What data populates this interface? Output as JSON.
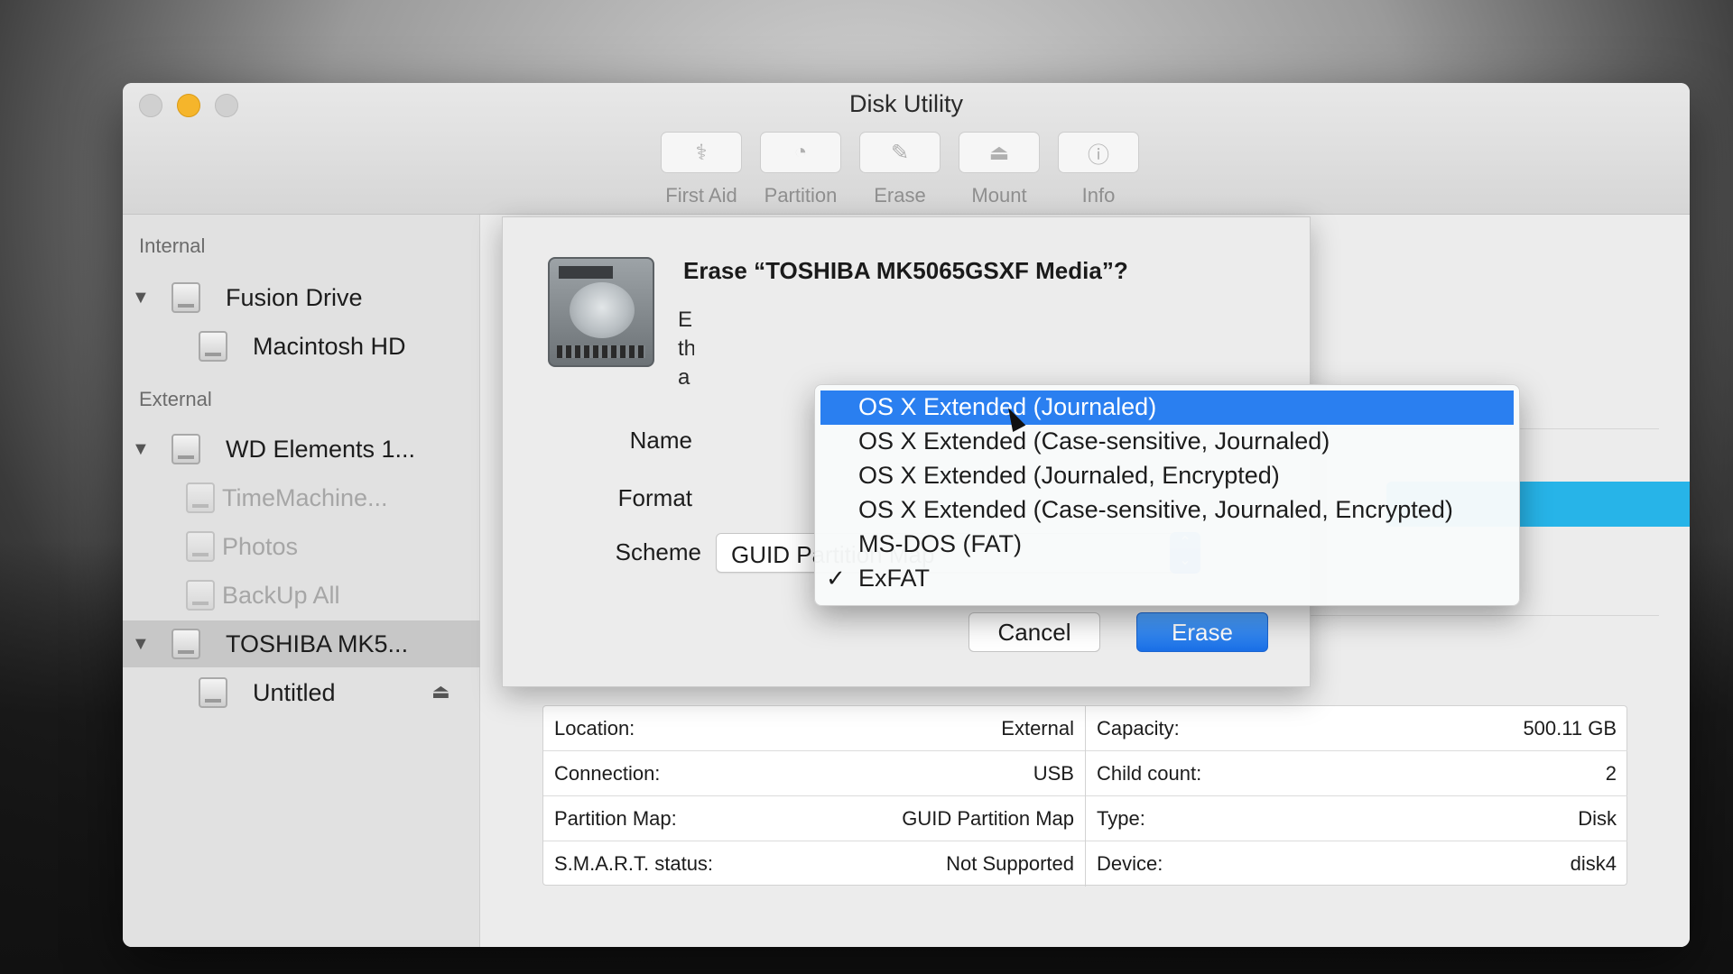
{
  "window": {
    "title": "Disk Utility"
  },
  "toolbar": [
    {
      "label": "First Aid",
      "icon": "stethoscope-icon",
      "glyph": "⚕"
    },
    {
      "label": "Partition",
      "icon": "pie-chart-icon",
      "glyph": "◔"
    },
    {
      "label": "Erase",
      "icon": "eraser-icon",
      "glyph": "✎"
    },
    {
      "label": "Mount",
      "icon": "mount-icon",
      "glyph": "⏏"
    },
    {
      "label": "Info",
      "icon": "info-icon",
      "glyph": "ⓘ"
    }
  ],
  "sidebar": {
    "internal_label": "Internal",
    "external_label": "External",
    "items": [
      {
        "label": "Fusion Drive"
      },
      {
        "label": "Macintosh HD"
      },
      {
        "label": "WD Elements 1..."
      },
      {
        "label": "TimeMachine..."
      },
      {
        "label": "Photos"
      },
      {
        "label": "BackUp All"
      },
      {
        "label": "TOSHIBA MK5..."
      },
      {
        "label": "Untitled"
      }
    ],
    "disclosure_glyph": "▼",
    "eject_glyph": "⏏"
  },
  "sheet": {
    "title": "Erase “TOSHIBA MK5065GSXF Media”?",
    "description_partial": "E\nth\na",
    "name_label": "Name",
    "format_label": "Format",
    "scheme_label": "Scheme",
    "scheme_value": "GUID Partition Map",
    "stepper_glyph": "⌃\n⌄",
    "cancel_label": "Cancel",
    "erase_label": "Erase"
  },
  "format_menu": {
    "check_glyph": "✓",
    "selected_value": "ExFAT",
    "items": [
      {
        "label": "OS X Extended (Journaled)",
        "highlighted": true,
        "checked": false
      },
      {
        "label": "OS X Extended (Case-sensitive, Journaled)",
        "highlighted": false,
        "checked": false
      },
      {
        "label": "OS X Extended (Journaled, Encrypted)",
        "highlighted": false,
        "checked": false
      },
      {
        "label": "OS X Extended (Case-sensitive, Journaled, Encrypted)",
        "highlighted": false,
        "checked": false
      },
      {
        "label": "MS-DOS (FAT)",
        "highlighted": false,
        "checked": false
      },
      {
        "label": "ExFAT",
        "highlighted": false,
        "checked": true
      }
    ]
  },
  "info": {
    "left": [
      {
        "key": "Location:",
        "value": "External"
      },
      {
        "key": "Connection:",
        "value": "USB"
      },
      {
        "key": "Partition Map:",
        "value": "GUID Partition Map"
      },
      {
        "key": "S.M.A.R.T. status:",
        "value": "Not Supported"
      }
    ],
    "right": [
      {
        "key": "Capacity:",
        "value": "500.11 GB"
      },
      {
        "key": "Child count:",
        "value": "2"
      },
      {
        "key": "Type:",
        "value": "Disk"
      },
      {
        "key": "Device:",
        "value": "disk4"
      }
    ]
  },
  "colors": {
    "accent_blue": "#2a7ff0",
    "minimize_yellow": "#f5b52b",
    "volume_bar_cyan": "#27b4e8"
  }
}
